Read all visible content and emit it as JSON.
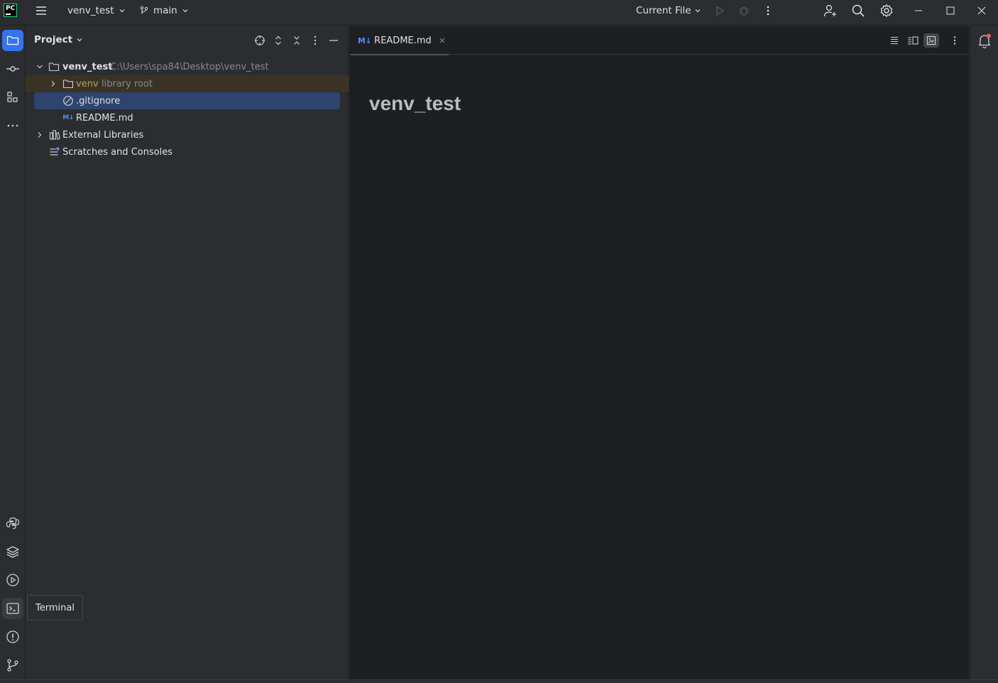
{
  "titlebar": {
    "project_name": "venv_test",
    "branch": "main",
    "run_config": "Current File",
    "icons": [
      "hamburger-menu-icon",
      "branch-icon",
      "run-icon",
      "debug-icon",
      "more-vert-icon",
      "add-user-icon",
      "search-icon",
      "gear-icon",
      "minimize-icon",
      "maximize-icon",
      "close-icon"
    ]
  },
  "left_stripe": {
    "top": [
      "folder-icon",
      "commit-icon",
      "structure-icon",
      "more-icon"
    ],
    "bottom": [
      "python-console-icon",
      "layers-icon",
      "services-icon",
      "terminal-icon",
      "problems-icon",
      "git-icon"
    ]
  },
  "project_panel": {
    "title": "Project",
    "tree": {
      "root_name": "venv_test",
      "root_path": "C:\\Users\\spa84\\Desktop\\venv_test",
      "venv_name": "venv",
      "venv_suffix": "library root",
      "gitignore": ".gitignore",
      "readme": "README.md",
      "external_libraries": "External Libraries",
      "scratches": "Scratches and Consoles"
    }
  },
  "editor": {
    "tab_icon": "M↓",
    "tab_label": "README.md",
    "preview_heading": "venv_test"
  },
  "tooltip": {
    "text": "Terminal"
  },
  "colors": {
    "accent": "#3574f0",
    "selection": "#2e436e",
    "library_row": "#3b3226",
    "notification_dot": "#e55765"
  }
}
